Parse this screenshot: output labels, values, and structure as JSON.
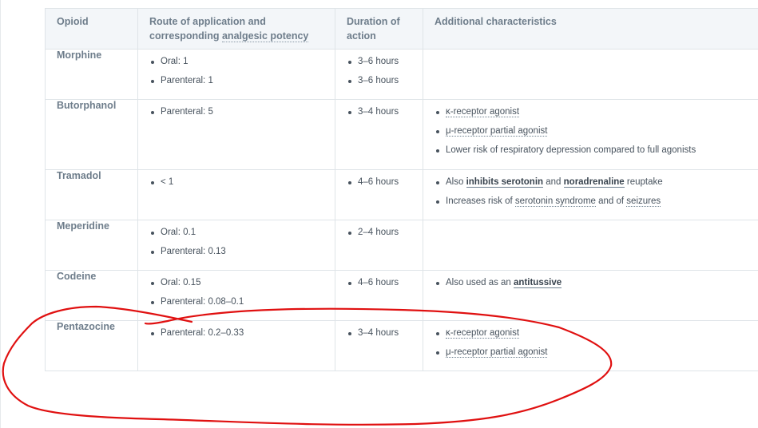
{
  "table": {
    "headers": {
      "opioid": "Opioid",
      "route_line1": "Route of application and",
      "route_line2_pre": "corresponding ",
      "route_line2_link": "analgesic potency",
      "duration_line1": "Duration of",
      "duration_line2": "action",
      "additional": "Additional characteristics"
    },
    "rows": {
      "morphine": {
        "name": "Morphine",
        "route": [
          "Oral: 1",
          "Parenteral: 1"
        ],
        "duration": [
          "3–6 hours",
          "3–6 hours"
        ]
      },
      "butorphanol": {
        "name": "Butorphanol",
        "route": [
          "Parenteral: 5"
        ],
        "duration": [
          "3–4 hours"
        ],
        "char1": "κ-receptor agonist",
        "char2": "μ-receptor partial agonist",
        "char3": "Lower risk of respiratory depression compared to full agonists"
      },
      "tramadol": {
        "name": "Tramadol",
        "route": [
          "< 1"
        ],
        "duration": [
          "4–6 hours"
        ],
        "char1_pre": "Also ",
        "char1_link1": "inhibits serotonin",
        "char1_mid": " and ",
        "char1_link2": "noradrenaline",
        "char1_post": " reuptake",
        "char2_pre": "Increases risk of ",
        "char2_link1": "serotonin syndrome",
        "char2_mid": " and of ",
        "char2_link2": "seizures"
      },
      "meperidine": {
        "name": "Meperidine",
        "route": [
          "Oral: 0.1",
          "Parenteral: 0.13"
        ],
        "duration": [
          "2–4 hours"
        ]
      },
      "codeine": {
        "name": "Codeine",
        "route": [
          "Oral: 0.15",
          "Parenteral: 0.08–0.1"
        ],
        "duration": [
          "4–6 hours"
        ],
        "char1_pre": "Also used as an ",
        "char1_link": "antitussive"
      },
      "pentazocine": {
        "name": "Pentazocine",
        "route": [
          "Parenteral: 0.2–0.33"
        ],
        "duration": [
          "3–4 hours"
        ],
        "char1": "κ-receptor agonist",
        "char2": "μ-receptor partial agonist"
      }
    }
  },
  "annotation": {
    "color": "#e01010"
  }
}
